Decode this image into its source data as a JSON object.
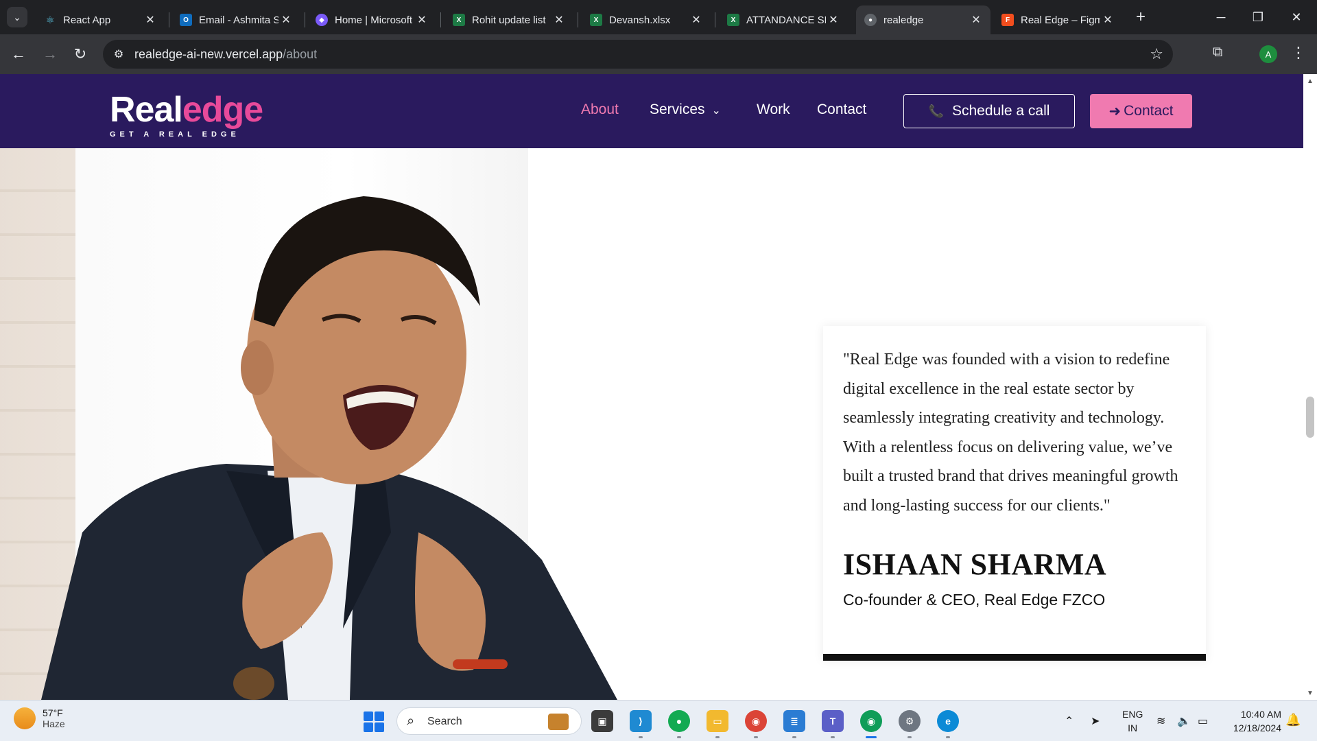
{
  "browser": {
    "tabs": [
      {
        "title": "React App",
        "favicon": "react-icon",
        "fav_color": "#61dafb",
        "active": false
      },
      {
        "title": "Email - Ashmita S",
        "favicon": "outlook-icon",
        "fav_color": "#0f6cbd",
        "active": false
      },
      {
        "title": "Home | Microsoft",
        "favicon": "copilot-icon",
        "fav_color": "#7a5af8",
        "active": false
      },
      {
        "title": "Rohit update list",
        "favicon": "excel-icon",
        "fav_color": "#1d7a45",
        "active": false
      },
      {
        "title": "Devansh.xlsx",
        "favicon": "excel-icon",
        "fav_color": "#1d7a45",
        "active": false
      },
      {
        "title": "ATTANDANCE SH",
        "favicon": "excel-icon",
        "fav_color": "#1d7a45",
        "active": false
      },
      {
        "title": "realedge",
        "favicon": "globe-icon",
        "fav_color": "#5f6368",
        "active": true
      },
      {
        "title": "Real Edge – Figma",
        "favicon": "figma-icon",
        "fav_color": "#f24e1e",
        "active": false
      }
    ],
    "url_host": "realedge-ai-new.vercel.app",
    "url_path": "/about",
    "profile_initial": "A"
  },
  "site": {
    "logo": {
      "word_a": "Real",
      "word_b": "edge",
      "tagline": "GET A REAL EDGE"
    },
    "nav": {
      "about": "About",
      "services": "Services",
      "work": "Work",
      "contact": "Contact"
    },
    "cta_call": "Schedule a call",
    "cta_contact": "Contact",
    "accent_color": "#f07ab0",
    "header_color": "#2a1a5e"
  },
  "quote": {
    "text": "\"Real Edge was founded with a vision to redefine digital excellence in the real estate sector by seamlessly integrating creativity and technology. With a relentless focus on delivering value, we’ve built a trusted brand that drives meaningful growth and long-lasting success for our clients.\"",
    "name": "ISHAAN SHARMA",
    "role": "Co-founder & CEO, Real Edge FZCO"
  },
  "taskbar": {
    "weather_temp": "57°F",
    "weather_cond": "Haze",
    "search_label": "Search",
    "lang_line1": "ENG",
    "lang_line2": "IN",
    "time": "10:40 AM",
    "date": "12/18/2024"
  }
}
